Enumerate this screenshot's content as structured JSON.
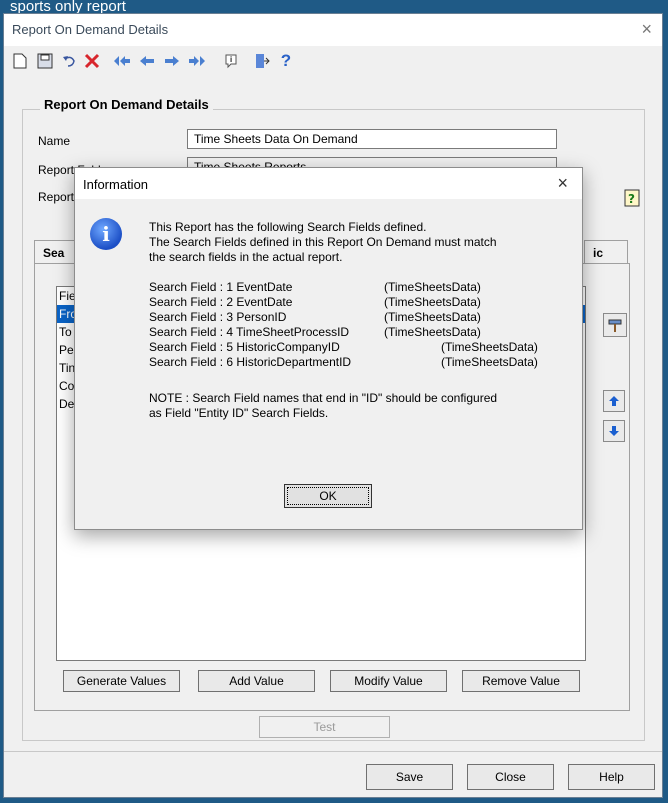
{
  "background": {
    "top_text": "sports only report"
  },
  "window": {
    "title": "Report On Demand Details",
    "close_glyph": "×"
  },
  "toolbar": {
    "icons": [
      "new-document-icon",
      "save-icon",
      "undo-icon",
      "delete-icon",
      "first-record-icon",
      "previous-record-icon",
      "next-record-icon",
      "last-record-icon",
      "info-icon",
      "exit-icon",
      "help-icon"
    ]
  },
  "group": {
    "title": "Report On Demand Details"
  },
  "form": {
    "name_label": "Name",
    "name_value": "Time Sheets Data On Demand",
    "folder_label": "Report Folder",
    "folder_value": "Time Sheets Reports",
    "report_label": "Report"
  },
  "tabs": [
    "Sea",
    "ic"
  ],
  "list": {
    "rows": [
      "Fie",
      "Fro",
      "To",
      "Pe",
      "Tin",
      "Co",
      "De"
    ],
    "selected_index": 1
  },
  "buttons": {
    "generate": "Generate Values",
    "add": "Add Value",
    "modify": "Modify Value",
    "remove": "Remove Value",
    "test": "Test",
    "save": "Save",
    "close": "Close",
    "help": "Help"
  },
  "dialog": {
    "title": "Information",
    "close_glyph": "×",
    "line1": "This Report has the following Search Fields defined.",
    "line2": "The Search Fields defined in this Report On Demand must match",
    "line3": "the search fields in the actual report.",
    "fields": [
      {
        "name": "Search Field : 1 EventDate",
        "source": "(TimeSheetsData)"
      },
      {
        "name": "Search Field : 2 EventDate",
        "source": "(TimeSheetsData)"
      },
      {
        "name": "Search Field : 3 PersonID",
        "source": "(TimeSheetsData)"
      },
      {
        "name": "Search Field : 4 TimeSheetProcessID",
        "source": "(TimeSheetsData)"
      },
      {
        "name": "Search Field : 5 HistoricCompanyID",
        "source": "(TimeSheetsData)"
      },
      {
        "name": "Search Field : 6 HistoricDepartmentID",
        "source": "(TimeSheetsData)"
      }
    ],
    "note1": "NOTE : Search Field names that end in \"ID\" should be configured",
    "note2": "as Field \"Entity ID\" Search Fields.",
    "ok": "OK"
  },
  "colors": {
    "accent": "#0a64c8",
    "frame": "#1f5a86"
  }
}
